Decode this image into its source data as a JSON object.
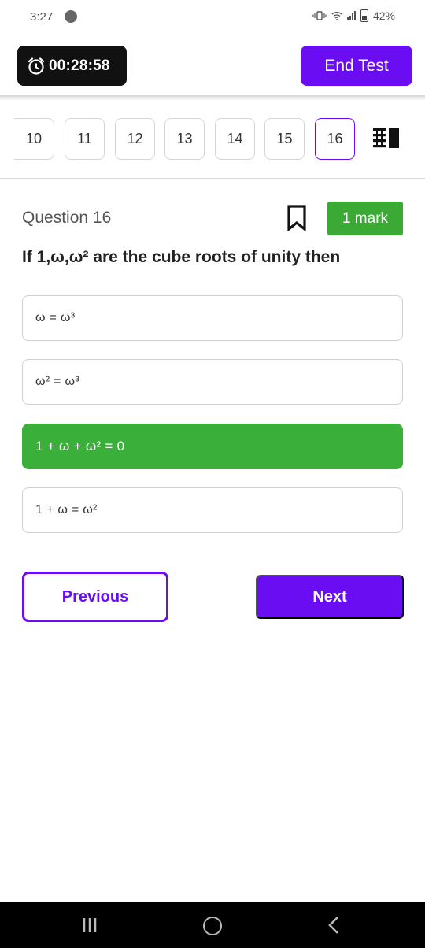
{
  "status_bar": {
    "time": "3:27",
    "battery": "42%",
    "icons": [
      "app-notification-icon",
      "vibrate-icon",
      "wifi-icon",
      "signal-icon",
      "battery-icon"
    ]
  },
  "header": {
    "timer": "00:28:58",
    "end_test_label": "End Test",
    "accent_color": "#6a0df2"
  },
  "navigator": {
    "questions": [
      "10",
      "11",
      "12",
      "13",
      "14",
      "15",
      "16"
    ],
    "current": "16"
  },
  "question": {
    "label": "Question 16",
    "marks": "1 mark",
    "text": "If 1,ω,ω² are the cube roots of unity then",
    "options": [
      {
        "text": "ω = ω³",
        "state": "default"
      },
      {
        "text": "ω² = ω³",
        "state": "default"
      },
      {
        "text": "1 + ω + ω² = 0",
        "state": "correct"
      },
      {
        "text": "1 + ω = ω²",
        "state": "default"
      }
    ],
    "correct_color": "#3aaf3a"
  },
  "footer": {
    "previous_label": "Previous",
    "next_label": "Next"
  }
}
